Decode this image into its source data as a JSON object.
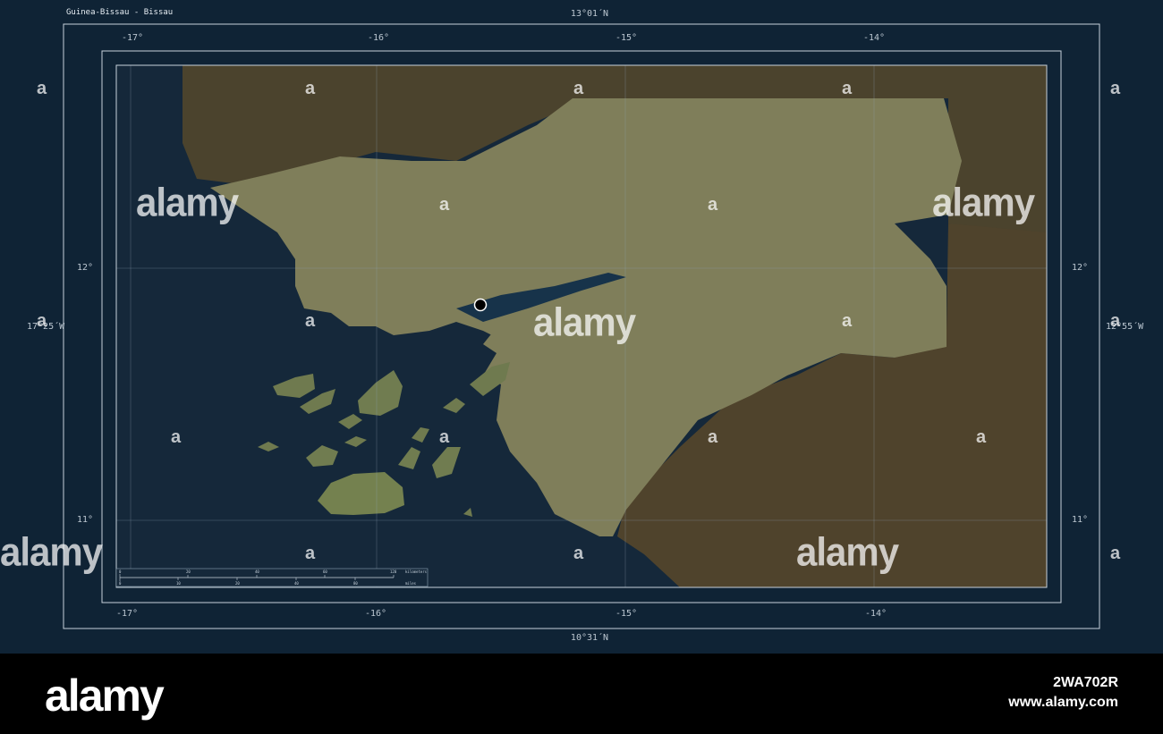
{
  "map": {
    "title": "Guinea-Bissau - Bissau",
    "lat_top_label": "13°01´N",
    "lat_bottom_label": "10°31´N",
    "lon_left_label": "17°25´W",
    "lon_right_label": "12°55´W",
    "lon_ticks": [
      "-17°",
      "-16°",
      "-15°",
      "-14°"
    ],
    "lat_ticks": [
      "12°",
      "11°"
    ],
    "capital": "Bissau",
    "scale_bar": {
      "units_top": "kilometers",
      "units_bottom": "miles",
      "km_ticks": [
        "0",
        "20",
        "40",
        "60",
        "120"
      ],
      "mi_ticks": [
        "0",
        "10",
        "20",
        "40",
        "80"
      ]
    }
  },
  "watermarks": {
    "word": "alamy",
    "letter": "a"
  },
  "footer": {
    "logo": "alamy",
    "image_id": "2WA702R",
    "url": "www.alamy.com"
  },
  "colors": {
    "frame_background": "#0f2335",
    "ocean": "#15283a",
    "country_highlight": "#7f7e5a",
    "neighbor_land": "#4b432d",
    "grid_line": "#8ea3b5",
    "footer_background": "#000000"
  }
}
